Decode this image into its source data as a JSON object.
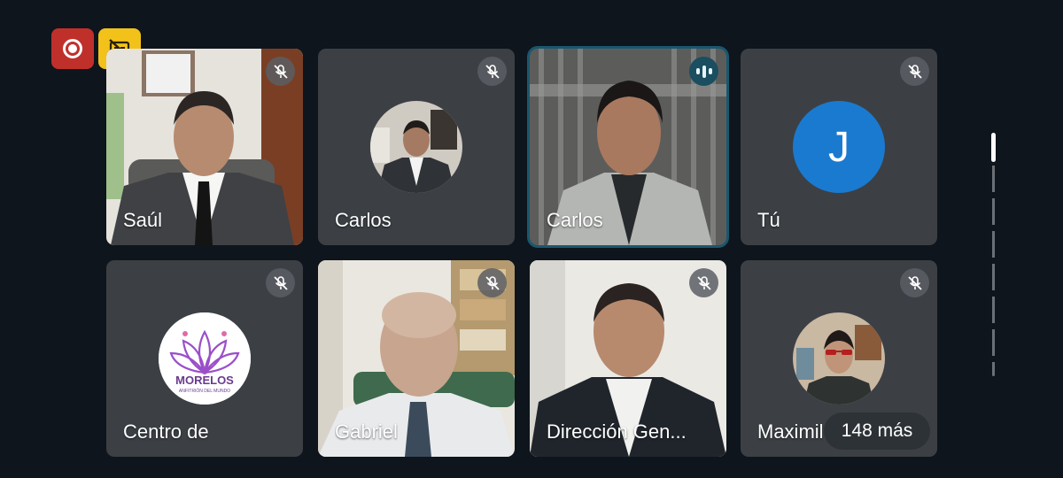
{
  "controls": {
    "record_icon": "record-icon",
    "captions_off_icon": "captions-off-icon",
    "record_color": "#c0302b",
    "captions_color": "#f2c21b"
  },
  "participants": [
    {
      "name": "Saúl",
      "muted": true,
      "type": "video"
    },
    {
      "name": "Carlos",
      "muted": true,
      "type": "photo-avatar"
    },
    {
      "name": "Carlos",
      "muted": false,
      "speaking": true,
      "type": "video"
    },
    {
      "name": "Tú",
      "muted": true,
      "type": "letter-avatar",
      "initial": "J"
    },
    {
      "name": "Centro de",
      "muted": true,
      "type": "logo-avatar",
      "logo_text": "MORELOS",
      "logo_subtext": "ANFITRIÓN DEL MUNDO"
    },
    {
      "name": "Gabriel",
      "muted": true,
      "type": "video"
    },
    {
      "name": "Dirección Gen...",
      "muted": true,
      "type": "video"
    },
    {
      "name": "Maximil",
      "muted": true,
      "type": "photo-avatar"
    }
  ],
  "overflow": {
    "label": "148 más"
  },
  "colors": {
    "background": "#0e151d",
    "tile": "#3c4045",
    "active_border": "#19576e",
    "letter_avatar": "#1a7ad0"
  }
}
